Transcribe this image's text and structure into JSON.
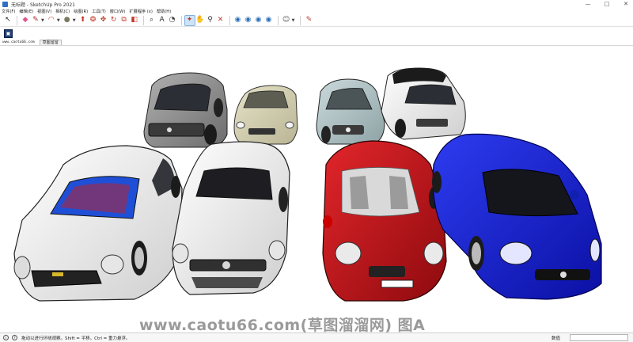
{
  "window": {
    "title": "无标题 - SketchUp Pro 2021",
    "controls": [
      "—",
      "□",
      "✕"
    ]
  },
  "menu": [
    "文件(F)",
    "编辑(E)",
    "视图(V)",
    "相机(C)",
    "绘图(R)",
    "工具(T)",
    "窗口(W)",
    "扩展程序 (x)",
    "帮助(H)"
  ],
  "toolbar": {
    "tools": [
      {
        "name": "select-tool",
        "glyph": "↖",
        "color": "#222222"
      },
      {
        "name": "eraser-tool",
        "glyph": "◆",
        "color": "#e2548c"
      },
      {
        "name": "pencil-tool",
        "glyph": "✎",
        "color": "#b12626"
      },
      {
        "name": "arc-tool",
        "glyph": "◠",
        "color": "#c0392b"
      },
      {
        "name": "shape-tool",
        "glyph": "●",
        "color": "#7a7a62"
      },
      {
        "name": "push-pull-tool",
        "glyph": "⬆",
        "color": "#c0392b"
      },
      {
        "name": "follow-me-tool",
        "glyph": "❂",
        "color": "#c0392b"
      },
      {
        "name": "move-tool",
        "glyph": "✥",
        "color": "#c0392b"
      },
      {
        "name": "rotate-tool",
        "glyph": "↻",
        "color": "#c0392b"
      },
      {
        "name": "scale-tool",
        "glyph": "⧉",
        "color": "#c0392b"
      },
      {
        "name": "offset-tool",
        "glyph": "◧",
        "color": "#c0392b"
      },
      {
        "name": "tape-measure-tool",
        "glyph": "⌕",
        "color": "#333333"
      },
      {
        "name": "dimension-tool",
        "glyph": "A",
        "color": "#333333"
      },
      {
        "name": "protractor-tool",
        "glyph": "◔",
        "color": "#333333"
      },
      {
        "name": "orbit-tool",
        "glyph": "✦",
        "color": "#c0392b"
      },
      {
        "name": "pan-tool",
        "glyph": "✋",
        "color": "#c08a2b"
      },
      {
        "name": "zoom-tool",
        "glyph": "⚲",
        "color": "#333333"
      },
      {
        "name": "zoom-extents-tool",
        "glyph": "✕",
        "color": "#c0392b"
      },
      {
        "name": "warehouse-tool",
        "glyph": "◉",
        "color": "#2a6fb8"
      },
      {
        "name": "extension-warehouse-tool",
        "glyph": "◉",
        "color": "#2a6fb8"
      },
      {
        "name": "share-model-tool",
        "glyph": "◉",
        "color": "#2a6fb8"
      },
      {
        "name": "layout-tool",
        "glyph": "◉",
        "color": "#2a6fb8"
      },
      {
        "name": "account-tool",
        "glyph": "☺",
        "color": "#555555"
      },
      {
        "name": "notes-tool",
        "glyph": "✎",
        "color": "#c0392b"
      }
    ]
  },
  "site_tag": "www.caotu66.com",
  "scene_tab": "草图溜溜",
  "watermark": "www.caotu66.com(草图溜溜网) 图A",
  "statusbar": {
    "hint": "拖动以进行环绕观察。Shift = 平移。Ctrl = 重力悬浮。",
    "measurements_label": "数值"
  },
  "colors": {
    "car_white": "#e9e9e9",
    "car_grey": "#8d8d8d",
    "car_cream": "#d6d2b4",
    "car_silver_blue": "#aec0c3",
    "car_red": "#c10c12",
    "car_blue": "#1a22d6"
  }
}
